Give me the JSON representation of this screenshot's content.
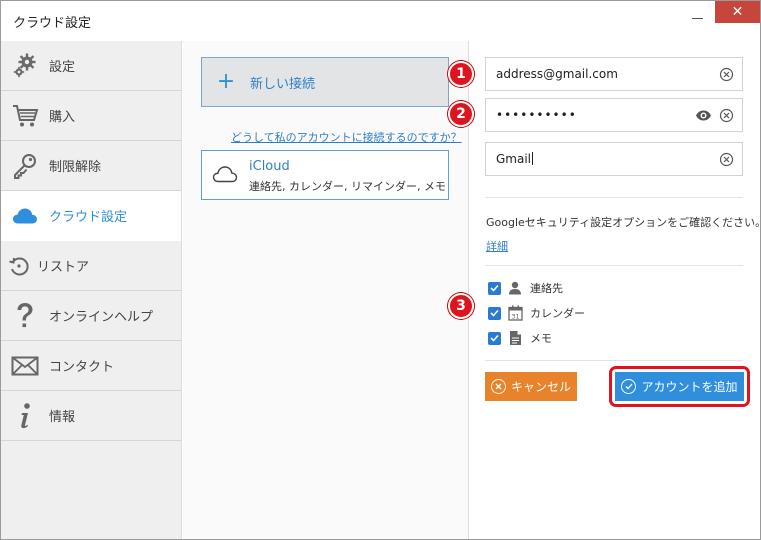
{
  "window": {
    "title": "クラウド設定",
    "close_glyph": "✕"
  },
  "sidebar": {
    "items": [
      {
        "label": "設定",
        "icon": "gear-icon"
      },
      {
        "label": "購入",
        "icon": "cart-icon"
      },
      {
        "label": "制限解除",
        "icon": "key-icon"
      },
      {
        "label": "クラウド設定",
        "icon": "cloud-icon",
        "active": true
      },
      {
        "label": "リストア",
        "icon": "restore-icon"
      },
      {
        "label": "オンラインヘルプ",
        "icon": "question-icon"
      },
      {
        "label": "コンタクト",
        "icon": "envelope-icon"
      },
      {
        "label": "情報",
        "icon": "info-icon"
      }
    ]
  },
  "middle": {
    "new_connection_label": "新しい接続",
    "plus_glyph": "+",
    "why_link": "どうして私のアカウントに接続するのですか？",
    "account": {
      "name": "iCloud",
      "services": "連絡先, カレンダー, リマインダー, メモ"
    }
  },
  "form": {
    "email": "address@gmail.com",
    "password_mask": "••••••••••",
    "account_name": "Gmail",
    "info_text": "Googleセキュリティ設定オプションをご確認ください。",
    "detail_link": "詳細",
    "checks": [
      {
        "label": "連絡先",
        "icon": "person-icon",
        "checked": true
      },
      {
        "label": "カレンダー",
        "icon": "calendar-icon",
        "checked": true
      },
      {
        "label": "メモ",
        "icon": "note-icon",
        "checked": true
      }
    ],
    "cancel_label": "キャンセル",
    "add_label": "アカウントを追加"
  },
  "annotations": {
    "badge1": "1",
    "badge2": "2",
    "badge3": "3"
  },
  "colors": {
    "accent": "#2f8fdd",
    "cancel": "#e8832b",
    "highlight": "#e0141e"
  }
}
